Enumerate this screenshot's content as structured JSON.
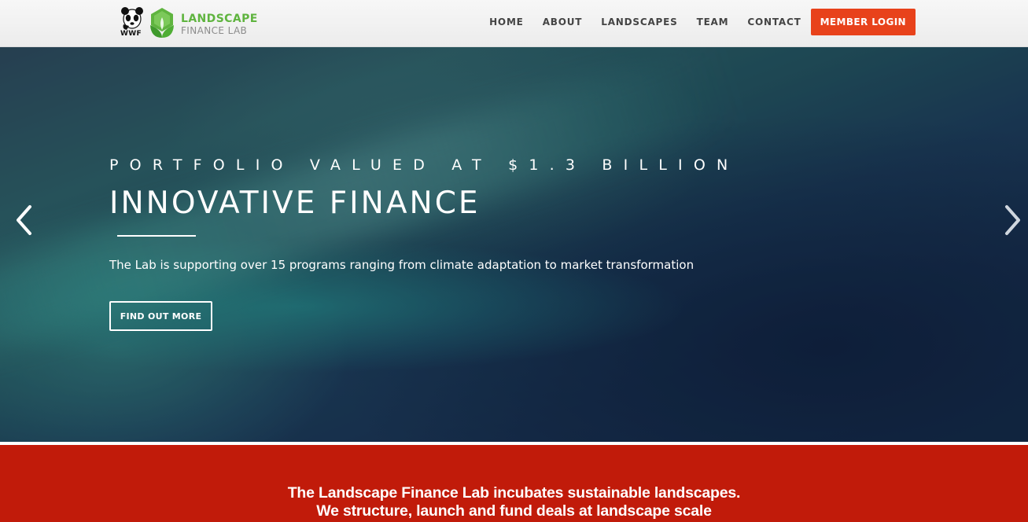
{
  "brand": {
    "partner_mark": "WWF",
    "name_line1": "LANDSCAPE",
    "name_line2": "FINANCE LAB",
    "colors": {
      "green": "#5fb43f",
      "gray": "#8c8c8c"
    }
  },
  "nav": {
    "items": [
      {
        "label": "HOME"
      },
      {
        "label": "ABOUT"
      },
      {
        "label": "LANDSCAPES"
      },
      {
        "label": "TEAM"
      },
      {
        "label": "CONTACT"
      }
    ],
    "login_label": "MEMBER LOGIN",
    "login_color": "#e8421b"
  },
  "hero": {
    "kicker": "PORTFOLIO VALUED AT $1.3 BILLION",
    "title": "INNOVATIVE FINANCE",
    "text": "The Lab is supporting over 15 programs ranging from climate adaptation to market transformation",
    "cta_label": "FIND OUT MORE",
    "prev_icon": "chevron-left-icon",
    "next_icon": "chevron-right-icon"
  },
  "intro": {
    "line1": "The Landscape Finance Lab incubates sustainable landscapes.",
    "line2": "We structure, launch and fund deals at landscape scale",
    "background": "#c11b0a"
  }
}
